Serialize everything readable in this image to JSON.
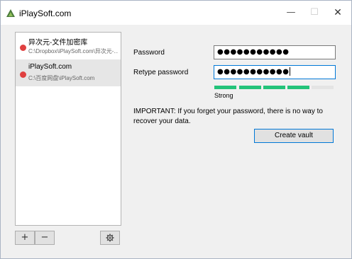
{
  "window": {
    "title": "iPlaySoft.com",
    "icons": {
      "app": "iplaysoft-logo-icon",
      "minimize": "minimize-icon",
      "maximize": "maximize-icon",
      "close": "close-icon"
    }
  },
  "vaults": [
    {
      "name": "异次元-文件加密库",
      "path": "C:\\Dropbox\\iPlaySoft.com\\异次元-...",
      "status_color": "#e04040",
      "selected": false
    },
    {
      "name": "iPlaySoft.com",
      "path": "C:\\百度网盘\\iPlaySoft.com",
      "status_color": "#e04040",
      "selected": true
    }
  ],
  "sidebar_buttons": {
    "add_label": "+",
    "remove_label": "−",
    "settings_icon": "gear-icon"
  },
  "form": {
    "password_label": "Password",
    "password_value": "●●●●●●●●●●●",
    "retype_label": "Retype password",
    "retype_value": "●●●●●●●●●●●",
    "strength": {
      "level": 4,
      "max": 5,
      "label": "Strong",
      "color": "#23c37a"
    },
    "warning": "IMPORTANT: If you forget your password, there is no way to recover your data.",
    "create_button": "Create vault"
  }
}
